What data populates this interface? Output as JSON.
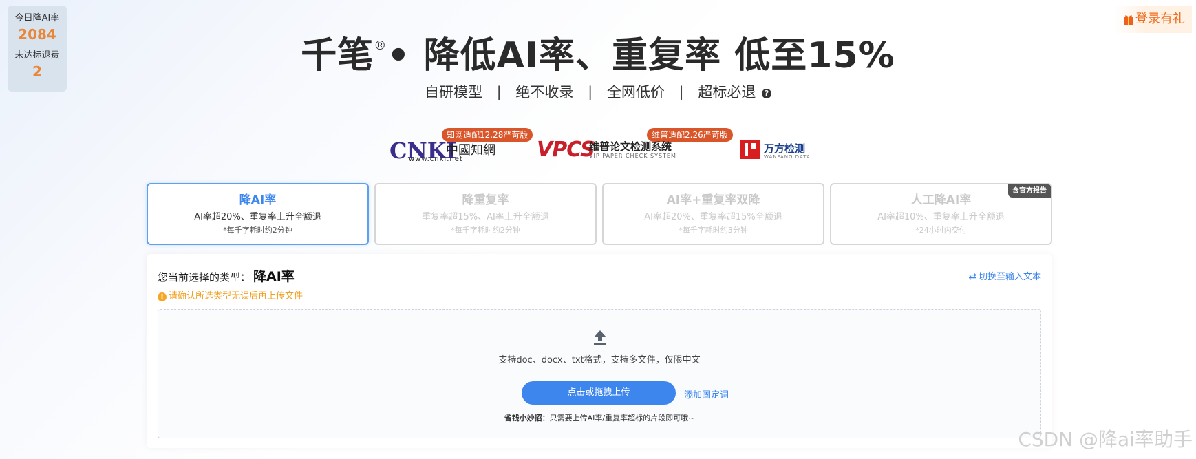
{
  "stats": {
    "today_label": "今日降AI率",
    "today_value": "2084",
    "refund_label": "未达标退费",
    "refund_value": "2"
  },
  "gift": {
    "label": "登录有礼",
    "icon": "gift-icon"
  },
  "header": {
    "title_part1": "千笔",
    "title_reg": "®",
    "title_part2": "• 降低AI率、重复率  低至15%",
    "subtitle": [
      "自研模型",
      "绝不收录",
      "全网低价",
      "超标必退"
    ],
    "separator": "|",
    "help_icon": "?"
  },
  "logos": {
    "cnki": {
      "badge": "知网适配12.28严苛版",
      "mark": "CNKI",
      "cn": "中國知網",
      "url": "www.cnki.net"
    },
    "vpcs": {
      "badge": "维普适配2.26严苛版",
      "mark": "VPCS",
      "cn": "维普论文检测系统",
      "en": "VIP PAPER CHECK SYSTEM"
    },
    "wanfang": {
      "cn": "万方检测",
      "en": "WANFANG DATA"
    }
  },
  "types": [
    {
      "title": "降AI率",
      "desc": "AI率超20%、重复率上升全额退",
      "note": "*每千字耗时约2分钟",
      "active": true
    },
    {
      "title": "降重复率",
      "desc": "重复率超15%、AI率上升全额退",
      "note": "*每千字耗时约2分钟"
    },
    {
      "title": "AI率+重复率双降",
      "desc": "AI率超20%、重复率超15%全额退",
      "note": "*每千字耗时约3分钟"
    },
    {
      "title": "人工降AI率",
      "desc": "AI率超10%、重复率上升全额退",
      "note": "*24小时内交付",
      "corner": "含官方报告"
    }
  ],
  "panel": {
    "selected_label": "您当前选择的类型：",
    "selected_value": "降AI率",
    "warning": "请确认所选类型无误后再上传文件",
    "warning_icon": "!",
    "switch_icon": "⇄",
    "switch_label": "切换至输入文本",
    "hint": "支持doc、docx、txt格式，支持多文件，仅限中文",
    "upload_button": "点击或拖拽上传",
    "fixed_words": "添加固定词",
    "tip_bold": "省钱小妙招：",
    "tip_text": "只需要上传AI率/重复率超标的片段即可哦~"
  },
  "watermark": "CSDN @降ai率助手"
}
